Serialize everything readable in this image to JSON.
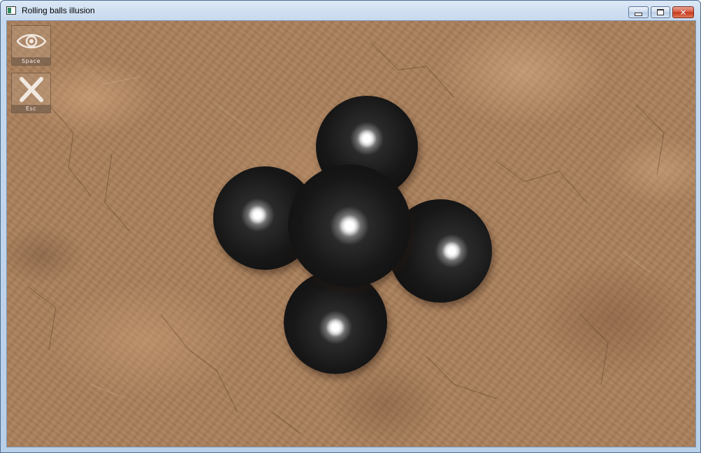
{
  "window": {
    "title": "Rolling balls illusion",
    "controls": {
      "minimize_icon": "minimize-icon",
      "maximize_icon": "maximize-icon",
      "close_icon": "close-icon",
      "close_glyph": "✕"
    }
  },
  "toolbar": {
    "view_button": {
      "icon": "eye-icon",
      "label": "Space"
    },
    "exit_button": {
      "icon": "x-icon",
      "label": "Esc"
    }
  },
  "scene": {
    "background": "stone-texture",
    "ball_color": "#1a1a1a",
    "highlight_color": "#ffffff",
    "ball_count": 5
  }
}
